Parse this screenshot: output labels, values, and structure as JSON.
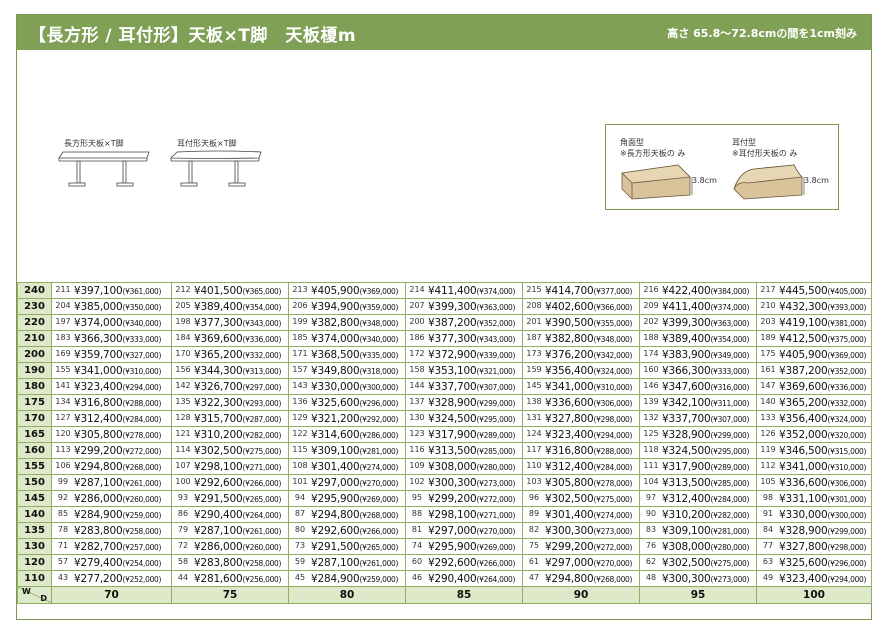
{
  "header": {
    "title": "【長方形 / 耳付形】天板×T脚　天板榎m",
    "note": "高さ 65.8〜72.8cmの間を1cm刻み"
  },
  "illustrations": {
    "rect_caption": "長方形天板×T脚",
    "ear_caption": "耳付形天板×T脚"
  },
  "profiles": {
    "square": {
      "title": "角面型",
      "note": "※長方形天板の み",
      "thickness": "3.8cm"
    },
    "ear": {
      "title": "耳付型",
      "note": "※耳付形天板の み",
      "thickness": "3.8cm"
    }
  },
  "table": {
    "corner_w": "W",
    "corner_d": "D",
    "depths": [
      "70",
      "75",
      "80",
      "85",
      "90",
      "95",
      "100"
    ],
    "rows": [
      {
        "w": "240",
        "cells": [
          [
            "211",
            "¥397,100",
            "(¥361,000)"
          ],
          [
            "212",
            "¥401,500",
            "(¥365,000)"
          ],
          [
            "213",
            "¥405,900",
            "(¥369,000)"
          ],
          [
            "214",
            "¥411,400",
            "(¥374,000)"
          ],
          [
            "215",
            "¥414,700",
            "(¥377,000)"
          ],
          [
            "216",
            "¥422,400",
            "(¥384,000)"
          ],
          [
            "217",
            "¥445,500",
            "(¥405,000)"
          ]
        ]
      },
      {
        "w": "230",
        "cells": [
          [
            "204",
            "¥385,000",
            "(¥350,000)"
          ],
          [
            "205",
            "¥389,400",
            "(¥354,000)"
          ],
          [
            "206",
            "¥394,900",
            "(¥359,000)"
          ],
          [
            "207",
            "¥399,300",
            "(¥363,000)"
          ],
          [
            "208",
            "¥402,600",
            "(¥366,000)"
          ],
          [
            "209",
            "¥411,400",
            "(¥374,000)"
          ],
          [
            "210",
            "¥432,300",
            "(¥393,000)"
          ]
        ]
      },
      {
        "w": "220",
        "cells": [
          [
            "197",
            "¥374,000",
            "(¥340,000)"
          ],
          [
            "198",
            "¥377,300",
            "(¥343,000)"
          ],
          [
            "199",
            "¥382,800",
            "(¥348,000)"
          ],
          [
            "200",
            "¥387,200",
            "(¥352,000)"
          ],
          [
            "201",
            "¥390,500",
            "(¥355,000)"
          ],
          [
            "202",
            "¥399,300",
            "(¥363,000)"
          ],
          [
            "203",
            "¥419,100",
            "(¥381,000)"
          ]
        ]
      },
      {
        "w": "210",
        "cells": [
          [
            "183",
            "¥366,300",
            "(¥333,000)"
          ],
          [
            "184",
            "¥369,600",
            "(¥336,000)"
          ],
          [
            "185",
            "¥374,000",
            "(¥340,000)"
          ],
          [
            "186",
            "¥377,300",
            "(¥343,000)"
          ],
          [
            "187",
            "¥382,800",
            "(¥348,000)"
          ],
          [
            "188",
            "¥389,400",
            "(¥354,000)"
          ],
          [
            "189",
            "¥412,500",
            "(¥375,000)"
          ]
        ]
      },
      {
        "w": "200",
        "cells": [
          [
            "169",
            "¥359,700",
            "(¥327,000)"
          ],
          [
            "170",
            "¥365,200",
            "(¥332,000)"
          ],
          [
            "171",
            "¥368,500",
            "(¥335,000)"
          ],
          [
            "172",
            "¥372,900",
            "(¥339,000)"
          ],
          [
            "173",
            "¥376,200",
            "(¥342,000)"
          ],
          [
            "174",
            "¥383,900",
            "(¥349,000)"
          ],
          [
            "175",
            "¥405,900",
            "(¥369,000)"
          ]
        ]
      },
      {
        "w": "190",
        "cells": [
          [
            "155",
            "¥341,000",
            "(¥310,000)"
          ],
          [
            "156",
            "¥344,300",
            "(¥313,000)"
          ],
          [
            "157",
            "¥349,800",
            "(¥318,000)"
          ],
          [
            "158",
            "¥353,100",
            "(¥321,000)"
          ],
          [
            "159",
            "¥356,400",
            "(¥324,000)"
          ],
          [
            "160",
            "¥366,300",
            "(¥333,000)"
          ],
          [
            "161",
            "¥387,200",
            "(¥352,000)"
          ]
        ]
      },
      {
        "w": "180",
        "cells": [
          [
            "141",
            "¥323,400",
            "(¥294,000)"
          ],
          [
            "142",
            "¥326,700",
            "(¥297,000)"
          ],
          [
            "143",
            "¥330,000",
            "(¥300,000)"
          ],
          [
            "144",
            "¥337,700",
            "(¥307,000)"
          ],
          [
            "145",
            "¥341,000",
            "(¥310,000)"
          ],
          [
            "146",
            "¥347,600",
            "(¥316,000)"
          ],
          [
            "147",
            "¥369,600",
            "(¥336,000)"
          ]
        ]
      },
      {
        "w": "175",
        "cells": [
          [
            "134",
            "¥316,800",
            "(¥288,000)"
          ],
          [
            "135",
            "¥322,300",
            "(¥293,000)"
          ],
          [
            "136",
            "¥325,600",
            "(¥296,000)"
          ],
          [
            "137",
            "¥328,900",
            "(¥299,000)"
          ],
          [
            "138",
            "¥336,600",
            "(¥306,000)"
          ],
          [
            "139",
            "¥342,100",
            "(¥311,000)"
          ],
          [
            "140",
            "¥365,200",
            "(¥332,000)"
          ]
        ]
      },
      {
        "w": "170",
        "cells": [
          [
            "127",
            "¥312,400",
            "(¥284,000)"
          ],
          [
            "128",
            "¥315,700",
            "(¥287,000)"
          ],
          [
            "129",
            "¥321,200",
            "(¥292,000)"
          ],
          [
            "130",
            "¥324,500",
            "(¥295,000)"
          ],
          [
            "131",
            "¥327,800",
            "(¥298,000)"
          ],
          [
            "132",
            "¥337,700",
            "(¥307,000)"
          ],
          [
            "133",
            "¥356,400",
            "(¥324,000)"
          ]
        ]
      },
      {
        "w": "165",
        "cells": [
          [
            "120",
            "¥305,800",
            "(¥278,000)"
          ],
          [
            "121",
            "¥310,200",
            "(¥282,000)"
          ],
          [
            "122",
            "¥314,600",
            "(¥286,000)"
          ],
          [
            "123",
            "¥317,900",
            "(¥289,000)"
          ],
          [
            "124",
            "¥323,400",
            "(¥294,000)"
          ],
          [
            "125",
            "¥328,900",
            "(¥299,000)"
          ],
          [
            "126",
            "¥352,000",
            "(¥320,000)"
          ]
        ]
      },
      {
        "w": "160",
        "cells": [
          [
            "113",
            "¥299,200",
            "(¥272,000)"
          ],
          [
            "114",
            "¥302,500",
            "(¥275,000)"
          ],
          [
            "115",
            "¥309,100",
            "(¥281,000)"
          ],
          [
            "116",
            "¥313,500",
            "(¥285,000)"
          ],
          [
            "117",
            "¥316,800",
            "(¥288,000)"
          ],
          [
            "118",
            "¥324,500",
            "(¥295,000)"
          ],
          [
            "119",
            "¥346,500",
            "(¥315,000)"
          ]
        ]
      },
      {
        "w": "155",
        "cells": [
          [
            "106",
            "¥294,800",
            "(¥268,000)"
          ],
          [
            "107",
            "¥298,100",
            "(¥271,000)"
          ],
          [
            "108",
            "¥301,400",
            "(¥274,000)"
          ],
          [
            "109",
            "¥308,000",
            "(¥280,000)"
          ],
          [
            "110",
            "¥312,400",
            "(¥284,000)"
          ],
          [
            "111",
            "¥317,900",
            "(¥289,000)"
          ],
          [
            "112",
            "¥341,000",
            "(¥310,000)"
          ]
        ]
      },
      {
        "w": "150",
        "cells": [
          [
            "99",
            "¥287,100",
            "(¥261,000)"
          ],
          [
            "100",
            "¥292,600",
            "(¥266,000)"
          ],
          [
            "101",
            "¥297,000",
            "(¥270,000)"
          ],
          [
            "102",
            "¥300,300",
            "(¥273,000)"
          ],
          [
            "103",
            "¥305,800",
            "(¥278,000)"
          ],
          [
            "104",
            "¥313,500",
            "(¥285,000)"
          ],
          [
            "105",
            "¥336,600",
            "(¥306,000)"
          ]
        ]
      },
      {
        "w": "145",
        "cells": [
          [
            "92",
            "¥286,000",
            "(¥260,000)"
          ],
          [
            "93",
            "¥291,500",
            "(¥265,000)"
          ],
          [
            "94",
            "¥295,900",
            "(¥269,000)"
          ],
          [
            "95",
            "¥299,200",
            "(¥272,000)"
          ],
          [
            "96",
            "¥302,500",
            "(¥275,000)"
          ],
          [
            "97",
            "¥312,400",
            "(¥284,000)"
          ],
          [
            "98",
            "¥331,100",
            "(¥301,000)"
          ]
        ]
      },
      {
        "w": "140",
        "cells": [
          [
            "85",
            "¥284,900",
            "(¥259,000)"
          ],
          [
            "86",
            "¥290,400",
            "(¥264,000)"
          ],
          [
            "87",
            "¥294,800",
            "(¥268,000)"
          ],
          [
            "88",
            "¥298,100",
            "(¥271,000)"
          ],
          [
            "89",
            "¥301,400",
            "(¥274,000)"
          ],
          [
            "90",
            "¥310,200",
            "(¥282,000)"
          ],
          [
            "91",
            "¥330,000",
            "(¥300,000)"
          ]
        ]
      },
      {
        "w": "135",
        "cells": [
          [
            "78",
            "¥283,800",
            "(¥258,000)"
          ],
          [
            "79",
            "¥287,100",
            "(¥261,000)"
          ],
          [
            "80",
            "¥292,600",
            "(¥266,000)"
          ],
          [
            "81",
            "¥297,000",
            "(¥270,000)"
          ],
          [
            "82",
            "¥300,300",
            "(¥273,000)"
          ],
          [
            "83",
            "¥309,100",
            "(¥281,000)"
          ],
          [
            "84",
            "¥328,900",
            "(¥299,000)"
          ]
        ]
      },
      {
        "w": "130",
        "cells": [
          [
            "71",
            "¥282,700",
            "(¥257,000)"
          ],
          [
            "72",
            "¥286,000",
            "(¥260,000)"
          ],
          [
            "73",
            "¥291,500",
            "(¥265,000)"
          ],
          [
            "74",
            "¥295,900",
            "(¥269,000)"
          ],
          [
            "75",
            "¥299,200",
            "(¥272,000)"
          ],
          [
            "76",
            "¥308,000",
            "(¥280,000)"
          ],
          [
            "77",
            "¥327,800",
            "(¥298,000)"
          ]
        ]
      },
      {
        "w": "120",
        "cells": [
          [
            "57",
            "¥279,400",
            "(¥254,000)"
          ],
          [
            "58",
            "¥283,800",
            "(¥258,000)"
          ],
          [
            "59",
            "¥287,100",
            "(¥261,000)"
          ],
          [
            "60",
            "¥292,600",
            "(¥266,000)"
          ],
          [
            "61",
            "¥297,000",
            "(¥270,000)"
          ],
          [
            "62",
            "¥302,500",
            "(¥275,000)"
          ],
          [
            "63",
            "¥325,600",
            "(¥296,000)"
          ]
        ]
      },
      {
        "w": "110",
        "cells": [
          [
            "43",
            "¥277,200",
            "(¥252,000)"
          ],
          [
            "44",
            "¥281,600",
            "(¥256,000)"
          ],
          [
            "45",
            "¥284,900",
            "(¥259,000)"
          ],
          [
            "46",
            "¥290,400",
            "(¥264,000)"
          ],
          [
            "47",
            "¥294,800",
            "(¥268,000)"
          ],
          [
            "48",
            "¥300,300",
            "(¥273,000)"
          ],
          [
            "49",
            "¥323,400",
            "(¥294,000)"
          ]
        ]
      }
    ]
  }
}
